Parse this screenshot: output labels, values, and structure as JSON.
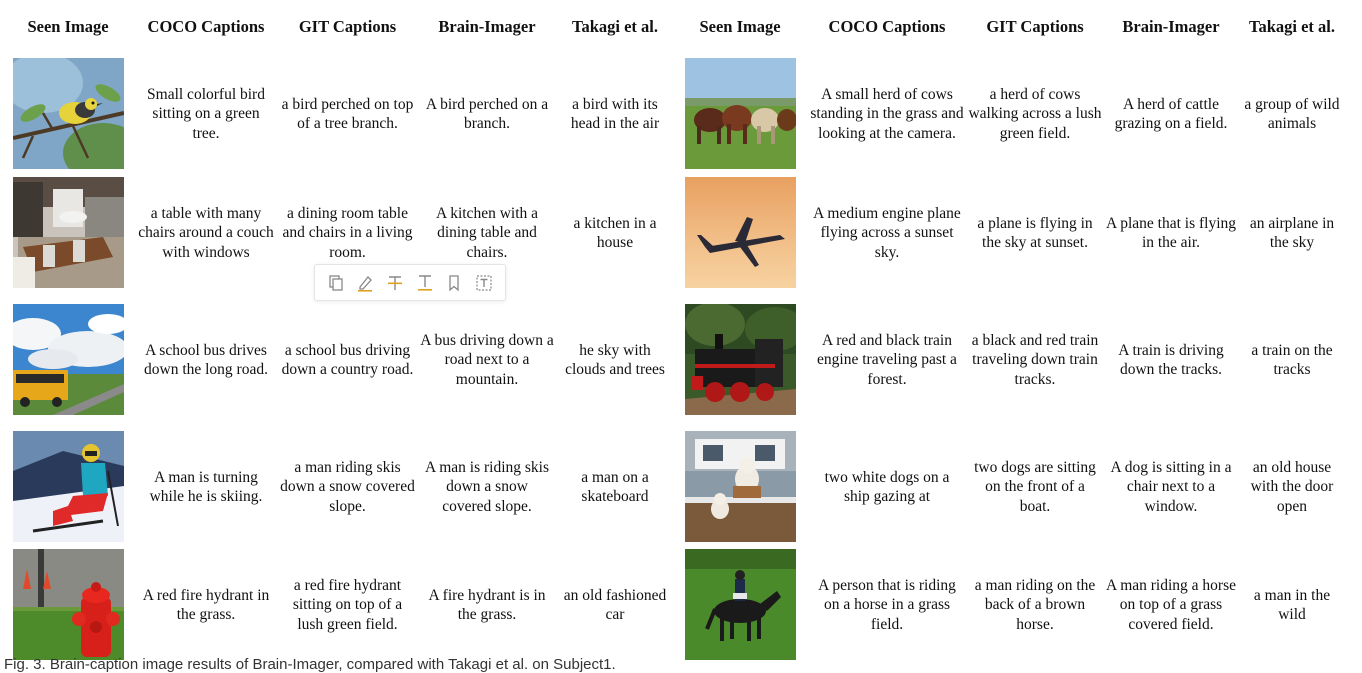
{
  "headers": [
    "Seen Image",
    "COCO Captions",
    "GIT Captions",
    "Brain-Imager",
    "Takagi et al.",
    "Seen Image",
    "COCO Captions",
    "GIT Captions",
    "Brain-Imager",
    "Takagi et al."
  ],
  "rows": [
    {
      "left_image": "bird on branch",
      "left": [
        "Small colorful bird sitting on a green tree.",
        "a bird perched on top of a tree branch.",
        "A bird perched on a branch.",
        "a bird with its head in the air"
      ],
      "right_image": "herd of cows in field",
      "right": [
        "A small herd of cows standing in the grass and looking at the camera.",
        "a herd of cows walking across a lush green field.",
        "A herd of cattle grazing on a field.",
        "a group of wild animals"
      ]
    },
    {
      "left_image": "dining room interior",
      "left": [
        "a table with many chairs around a couch with windows",
        "a dining room table and chairs in a living room.",
        "A kitchen with a dining table and chairs.",
        "a kitchen in a house"
      ],
      "right_image": "airplane at sunset",
      "right": [
        "A medium engine plane flying across a sunset sky.",
        "a plane is flying in the sky at sunset.",
        "A plane that is flying in the air.",
        "an airplane in the sky"
      ]
    },
    {
      "left_image": "school bus on road under clouds",
      "left": [
        "A school bus drives down the long road.",
        "a school bus driving down a country road.",
        "A bus driving down a road next to a mountain.",
        "he sky with clouds and trees"
      ],
      "right_image": "steam train",
      "right": [
        "A red and black train engine traveling past a forest.",
        "a black and red train traveling down train tracks.",
        "A train is driving down the tracks.",
        "a train on the tracks"
      ]
    },
    {
      "left_image": "skier",
      "left": [
        "A man is turning while he is skiing.",
        "a man riding skis down a snow covered slope.",
        "A man is riding skis down a snow covered slope.",
        "a man on a skateboard"
      ],
      "right_image": "dogs on boat",
      "right": [
        "two white dogs on a ship gazing at",
        "two dogs are sitting on the front of a boat.",
        "A dog is sitting in a chair next to a window.",
        "an old house with the door open"
      ]
    },
    {
      "left_image": "red fire hydrant",
      "left": [
        "A red fire hydrant in the grass.",
        "a red fire hydrant sitting on top of a lush green field.",
        "A fire hydrant is in the grass.",
        "an old fashioned car"
      ],
      "right_image": "horse rider",
      "right": [
        "A person that is riding on a horse in a grass field.",
        "a man riding on the back of a brown horse.",
        "A man riding a horse on top of a grass covered field.",
        "a man in the wild"
      ]
    }
  ],
  "toolbar": {
    "icons": [
      "copy-icon",
      "highlight-pen-icon",
      "strikethrough-text-icon",
      "underline-text-icon",
      "bookmark-icon",
      "text-box-icon"
    ],
    "accent": "#e0a020"
  },
  "caption": "Fig. 3. Brain-caption image results of Brain-Imager, compared with Takagi et al. on Subject1."
}
